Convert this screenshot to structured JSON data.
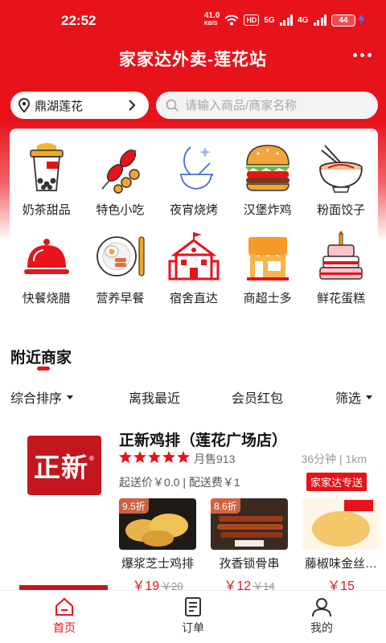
{
  "status_bar": {
    "time": "22:52",
    "net_speed": "41.0",
    "net_speed_unit": "KB/S",
    "hd_label": "HD",
    "sig1_label": "5G",
    "sig2_label": "4G",
    "battery": "44"
  },
  "header": {
    "title": "家家达外卖-莲花站",
    "more_icon": "more-dots-icon"
  },
  "location": {
    "label": "鼎湖莲花"
  },
  "search": {
    "placeholder": "请输入商品/商家名称"
  },
  "categories": [
    {
      "label": "奶茶甜品",
      "icon": "bubble-tea-icon"
    },
    {
      "label": "特色小吃",
      "icon": "skewer-icon"
    },
    {
      "label": "夜宵烧烤",
      "icon": "moon-bowl-icon"
    },
    {
      "label": "汉堡炸鸡",
      "icon": "burger-icon"
    },
    {
      "label": "粉面饺子",
      "icon": "noodle-bowl-icon"
    },
    {
      "label": "快餐烧腊",
      "icon": "food-cloche-icon"
    },
    {
      "label": "营养早餐",
      "icon": "breakfast-plate-icon"
    },
    {
      "label": "宿舍直达",
      "icon": "school-building-icon"
    },
    {
      "label": "商超士多",
      "icon": "shop-icon"
    },
    {
      "label": "鲜花蛋糕",
      "icon": "birthday-cake-icon"
    }
  ],
  "nearby": {
    "title": "附近商家",
    "filters": [
      "综合排序",
      "离我最近",
      "会员红包",
      "筛选"
    ]
  },
  "shop": {
    "logo_text": "正新",
    "logo_mark": "®",
    "name": "正新鸡排（莲花广场店）",
    "rating_stars": 5,
    "monthly_sales": "月售913",
    "distance": "36分钟 | 1km",
    "fee_text": "起送价￥0.0 | 配送费￥1",
    "delivery_badge": "家家达专送",
    "dishes": [
      {
        "discount": "9.5折",
        "name": "爆浆芝士鸡排",
        "price": "￥19",
        "original": "￥20"
      },
      {
        "discount": "8.6折",
        "name": "孜香锁骨串",
        "price": "￥12",
        "original": "￥14"
      },
      {
        "discount": "",
        "name": "藤椒味金丝…",
        "price": "￥15",
        "original": ""
      }
    ]
  },
  "tabbar": {
    "items": [
      {
        "label": "首页",
        "icon": "home-icon",
        "active": true
      },
      {
        "label": "订单",
        "icon": "order-list-icon",
        "active": false
      },
      {
        "label": "我的",
        "icon": "user-icon",
        "active": false
      }
    ]
  },
  "colors": {
    "brand_red": "#e8121b",
    "logo_red": "#c4161e"
  }
}
